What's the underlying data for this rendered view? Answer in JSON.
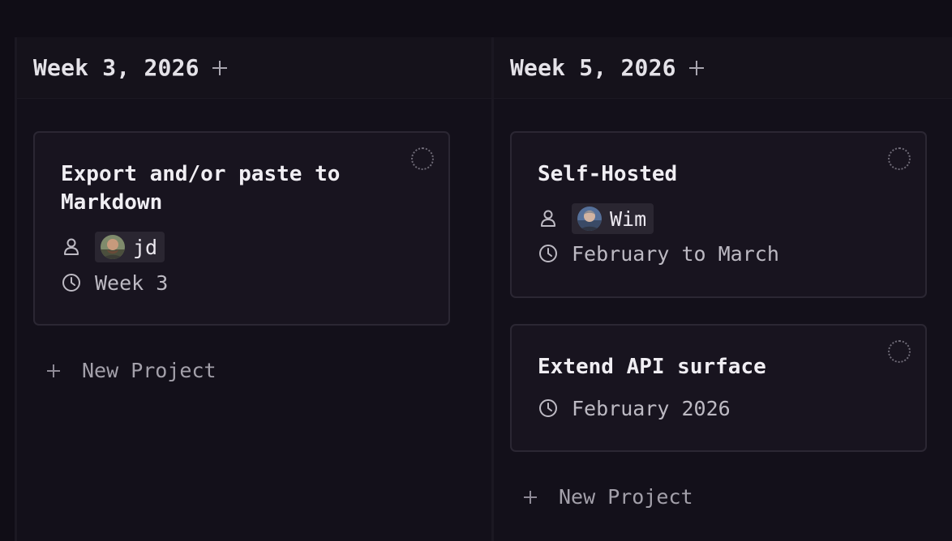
{
  "columns": [
    {
      "title": "Week 3, 2026",
      "cards": [
        {
          "title": "Export and/or paste to Markdown",
          "assignee": "jd",
          "timeframe": "Week 3"
        }
      ],
      "new_project_label": "New Project"
    },
    {
      "title": "Week 5, 2026",
      "cards": [
        {
          "title": "Self-Hosted",
          "assignee": "Wim",
          "timeframe": "February to March"
        },
        {
          "title": "Extend API surface",
          "timeframe": "February 2026"
        }
      ],
      "new_project_label": "New Project"
    }
  ],
  "icons": {
    "add": "plus-icon",
    "assignee": "person-icon",
    "timeframe": "clock-icon",
    "status": "status-circle-icon"
  },
  "colors": {
    "background": "#100d16",
    "card": "#18141f",
    "chip": "#2a2631"
  }
}
